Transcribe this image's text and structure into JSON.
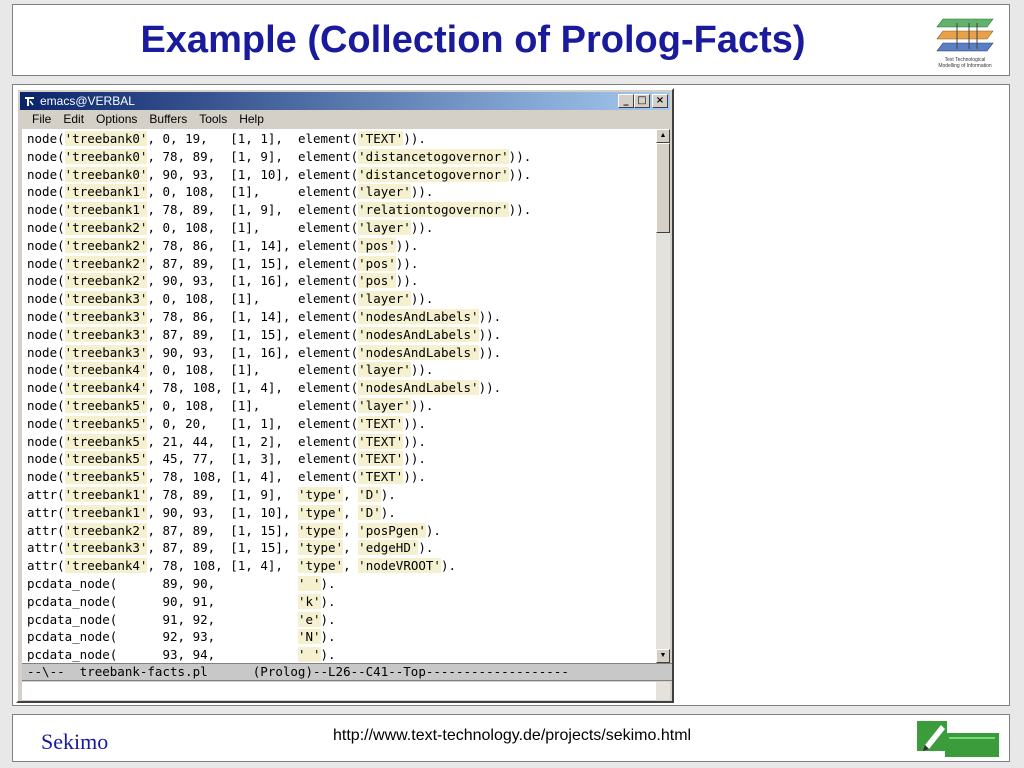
{
  "slide": {
    "title": "Example (Collection of Prolog-Facts)",
    "logo_caption_line1": "Text Technological",
    "logo_caption_line2": "Modelling of Information",
    "footer_left": "Sekimo",
    "footer_url": "http://www.text-technology.de/projects/sekimo.html"
  },
  "window": {
    "title": "emacs@VERBAL",
    "buttons": [
      "_",
      "□",
      "×"
    ]
  },
  "menu": {
    "items": [
      "File",
      "Edit",
      "Options",
      "Buffers",
      "Tools",
      "Help"
    ]
  },
  "buffer": {
    "lines": [
      [
        {
          "t": "node("
        },
        {
          "s": "'treebank0'"
        },
        {
          "t": ", 0, 19,   [1, 1],  element("
        },
        {
          "s": "'TEXT'"
        },
        {
          "t": "))."
        }
      ],
      [
        {
          "t": "node("
        },
        {
          "s": "'treebank0'"
        },
        {
          "t": ", 78, 89,  [1, 9],  element("
        },
        {
          "s": "'distancetogovernor'"
        },
        {
          "t": "))."
        }
      ],
      [
        {
          "t": "node("
        },
        {
          "s": "'treebank0'"
        },
        {
          "t": ", 90, 93,  [1, 10], element("
        },
        {
          "s": "'distancetogovernor'"
        },
        {
          "t": "))."
        }
      ],
      [
        {
          "t": "node("
        },
        {
          "s": "'treebank1'"
        },
        {
          "t": ", 0, 108,  [1],     element("
        },
        {
          "s": "'layer'"
        },
        {
          "t": "))."
        }
      ],
      [
        {
          "t": "node("
        },
        {
          "s": "'treebank1'"
        },
        {
          "t": ", 78, 89,  [1, 9],  element("
        },
        {
          "s": "'relationtogovernor'"
        },
        {
          "t": "))."
        }
      ],
      [
        {
          "t": "node("
        },
        {
          "s": "'treebank2'"
        },
        {
          "t": ", 0, 108,  [1],     element("
        },
        {
          "s": "'layer'"
        },
        {
          "t": "))."
        }
      ],
      [
        {
          "t": "node("
        },
        {
          "s": "'treebank2'"
        },
        {
          "t": ", 78, 86,  [1, 14], element("
        },
        {
          "s": "'pos'"
        },
        {
          "t": "))."
        }
      ],
      [
        {
          "t": "node("
        },
        {
          "s": "'treebank2'"
        },
        {
          "t": ", 87, 89,  [1, 15], element("
        },
        {
          "s": "'pos'"
        },
        {
          "t": "))."
        }
      ],
      [
        {
          "t": "node("
        },
        {
          "s": "'treebank2'"
        },
        {
          "t": ", 90, 93,  [1, 16], element("
        },
        {
          "s": "'pos'"
        },
        {
          "t": "))."
        }
      ],
      [
        {
          "t": "node("
        },
        {
          "s": "'treebank3'"
        },
        {
          "t": ", 0, 108,  [1],     element("
        },
        {
          "s": "'layer'"
        },
        {
          "t": "))."
        }
      ],
      [
        {
          "t": "node("
        },
        {
          "s": "'treebank3'"
        },
        {
          "t": ", 78, 86,  [1, 14], element("
        },
        {
          "s": "'nodesAndLabels'"
        },
        {
          "t": "))."
        }
      ],
      [
        {
          "t": "node("
        },
        {
          "s": "'treebank3'"
        },
        {
          "t": ", 87, 89,  [1, 15], element("
        },
        {
          "s": "'nodesAndLabels'"
        },
        {
          "t": "))."
        }
      ],
      [
        {
          "t": "node("
        },
        {
          "s": "'treebank3'"
        },
        {
          "t": ", 90, 93,  [1, 16], element("
        },
        {
          "s": "'nodesAndLabels'"
        },
        {
          "t": "))."
        }
      ],
      [
        {
          "t": "node("
        },
        {
          "s": "'treebank4'"
        },
        {
          "t": ", 0, 108,  [1],     element("
        },
        {
          "s": "'layer'"
        },
        {
          "t": "))."
        }
      ],
      [
        {
          "t": "node("
        },
        {
          "s": "'treebank4'"
        },
        {
          "t": ", 78, 108, [1, 4],  element("
        },
        {
          "s": "'nodesAndLabels'"
        },
        {
          "t": "))."
        }
      ],
      [
        {
          "t": "node("
        },
        {
          "s": "'treebank5'"
        },
        {
          "t": ", 0, 108,  [1],     element("
        },
        {
          "s": "'layer'"
        },
        {
          "t": "))."
        }
      ],
      [
        {
          "t": "node("
        },
        {
          "s": "'treebank5'"
        },
        {
          "t": ", 0, 20,   [1, 1],  element("
        },
        {
          "s": "'TEXT'"
        },
        {
          "t": "))."
        }
      ],
      [
        {
          "t": "node("
        },
        {
          "s": "'treebank5'"
        },
        {
          "t": ", 21, 44,  [1, 2],  element("
        },
        {
          "s": "'TEXT'"
        },
        {
          "t": "))."
        }
      ],
      [
        {
          "t": "node("
        },
        {
          "s": "'treebank5'"
        },
        {
          "t": ", 45, 77,  [1, 3],  element("
        },
        {
          "s": "'TEXT'"
        },
        {
          "t": "))."
        }
      ],
      [
        {
          "t": "node("
        },
        {
          "s": "'treebank5'"
        },
        {
          "t": ", 78, 108, [1, 4],  element("
        },
        {
          "s": "'TEXT'"
        },
        {
          "t": "))."
        }
      ],
      [
        {
          "t": "attr("
        },
        {
          "s": "'treebank1'"
        },
        {
          "t": ", 78, 89,  [1, 9],  "
        },
        {
          "s": "'type'"
        },
        {
          "t": ", "
        },
        {
          "s": "'D'"
        },
        {
          "t": ")."
        }
      ],
      [
        {
          "t": "attr("
        },
        {
          "s": "'treebank1'"
        },
        {
          "t": ", 90, 93,  [1, 10], "
        },
        {
          "s": "'type'"
        },
        {
          "t": ", "
        },
        {
          "s": "'D'"
        },
        {
          "t": ")."
        }
      ],
      [
        {
          "t": "attr("
        },
        {
          "s": "'treebank2'"
        },
        {
          "t": ", 87, 89,  [1, 15], "
        },
        {
          "s": "'type'"
        },
        {
          "t": ", "
        },
        {
          "s": "'posPgen'"
        },
        {
          "t": ")."
        }
      ],
      [
        {
          "t": "attr("
        },
        {
          "s": "'treebank3'"
        },
        {
          "t": ", 87, 89,  [1, 15], "
        },
        {
          "s": "'type'"
        },
        {
          "t": ", "
        },
        {
          "s": "'edgeHD'"
        },
        {
          "t": ")."
        }
      ],
      [
        {
          "t": "attr("
        },
        {
          "s": "'treebank4'"
        },
        {
          "t": ", 78, 108, [1, 4],  "
        },
        {
          "s": "'type'"
        },
        {
          "t": ", "
        },
        {
          "s": "'nodeVROOT'"
        },
        {
          "t": ")."
        }
      ],
      [
        {
          "t": "pcdata_node(      89, 90,           "
        },
        {
          "s": "' '"
        },
        {
          "t": ")."
        }
      ],
      [
        {
          "t": "pcdata_node(      90, 91,           "
        },
        {
          "s": "'k'"
        },
        {
          "t": ")."
        }
      ],
      [
        {
          "t": "pcdata_node(      91, 92,           "
        },
        {
          "s": "'e'"
        },
        {
          "t": ")."
        }
      ],
      [
        {
          "t": "pcdata_node(      92, 93,           "
        },
        {
          "s": "'N'"
        },
        {
          "t": ")."
        }
      ],
      [
        {
          "t": "pcdata_node(      93, 94,           "
        },
        {
          "s": "' '"
        },
        {
          "t": ")."
        }
      ]
    ]
  },
  "modeline": {
    "text": "--\\--  treebank-facts.pl      (Prolog)--L26--C41--Top-------------------"
  },
  "colors": {
    "title_blue": "#1a1a9c",
    "titlebar_start": "#0a246a",
    "titlebar_end": "#a6caf0",
    "string_highlight": "#f4f0d0"
  }
}
